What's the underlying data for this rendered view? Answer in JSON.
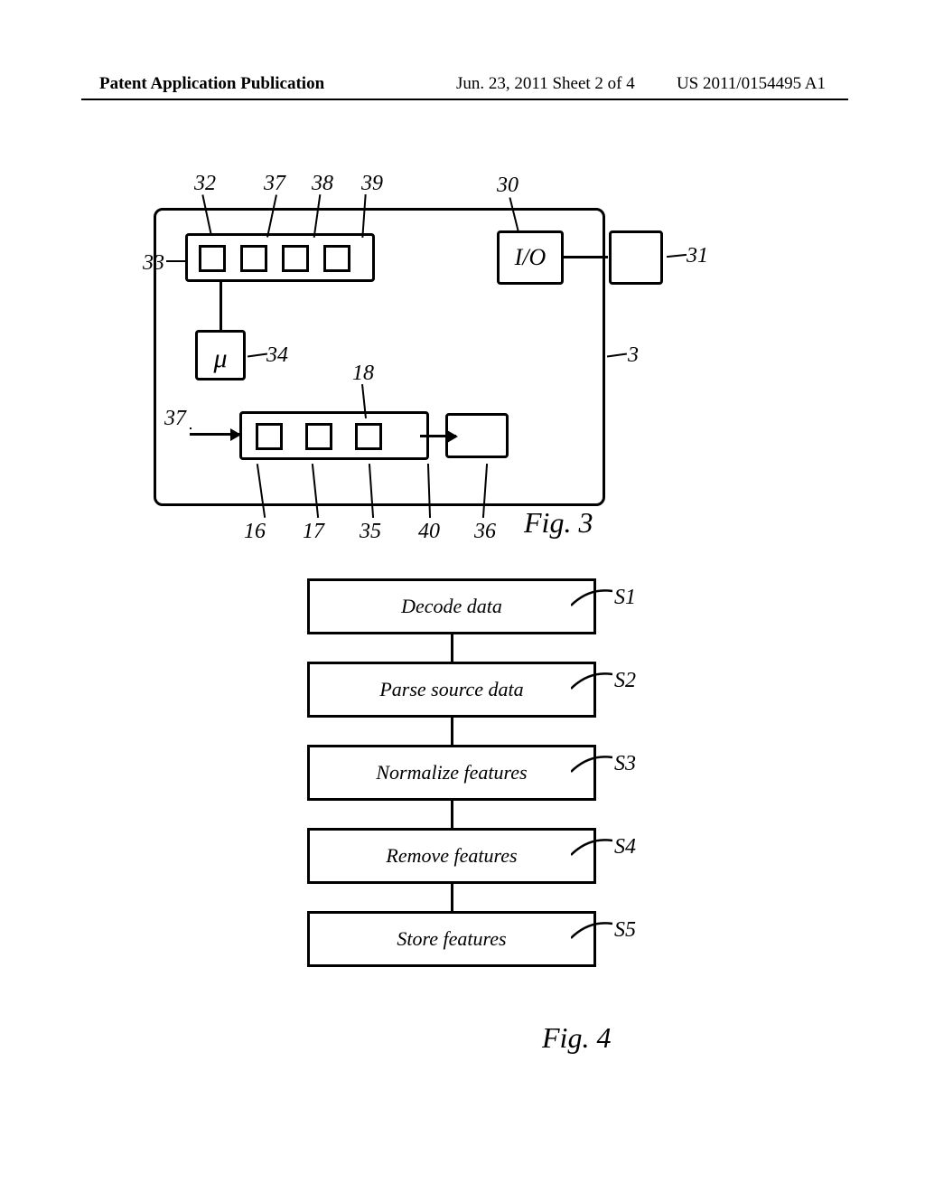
{
  "header": {
    "left": "Patent Application Publication",
    "center": "Jun. 23, 2011  Sheet 2 of 4",
    "right": "US 2011/0154495 A1"
  },
  "fig3": {
    "caption": "Fig. 3",
    "io_label": "I/O",
    "mu_label": "μ",
    "labels": {
      "n3": "3",
      "n16": "16",
      "n17": "17",
      "n18": "18",
      "n30": "30",
      "n31": "31",
      "n32": "32",
      "n33": "33",
      "n34": "34",
      "n35": "35",
      "n36": "36",
      "n37a": "37",
      "n37b": "37",
      "n38": "38",
      "n39": "39",
      "n40": "40"
    }
  },
  "fig4": {
    "caption": "Fig. 4",
    "steps": [
      {
        "id": "S1",
        "text": "Decode data"
      },
      {
        "id": "S2",
        "text": "Parse source data"
      },
      {
        "id": "S3",
        "text": "Normalize features"
      },
      {
        "id": "S4",
        "text": "Remove features"
      },
      {
        "id": "S5",
        "text": "Store features"
      }
    ]
  }
}
